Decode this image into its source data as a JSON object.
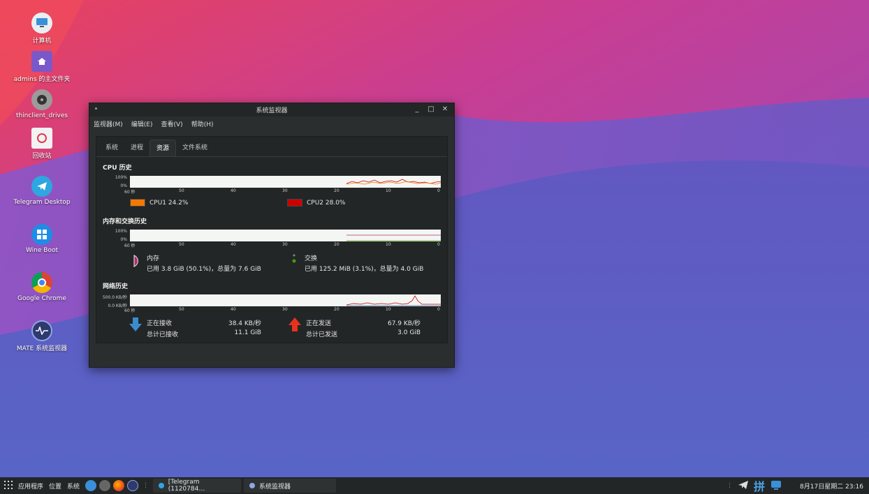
{
  "desktop": {
    "icons": [
      {
        "label": "计算机",
        "icon": "computer-icon"
      },
      {
        "label": "admins 的主文件夹",
        "icon": "home-folder-icon"
      },
      {
        "label": "thinclient_drives",
        "icon": "drive-icon"
      },
      {
        "label": "回收站",
        "icon": "trash-icon"
      },
      {
        "label": "Telegram Desktop",
        "icon": "telegram-icon"
      },
      {
        "label": "Wine Boot",
        "icon": "windows-icon"
      },
      {
        "label": "Google Chrome",
        "icon": "chrome-icon"
      },
      {
        "label": "MATE 系统监视器",
        "icon": "system-monitor-icon"
      }
    ]
  },
  "window": {
    "title": "系统监视器",
    "menu": [
      "监视器(M)",
      "编辑(E)",
      "查看(V)",
      "帮助(H)"
    ],
    "tabs": [
      "系统",
      "进程",
      "资源",
      "文件系统"
    ],
    "active_tab": "资源"
  },
  "cpu": {
    "title": "CPU 历史",
    "y_top": "100%",
    "y_bottom": "0%",
    "x_labels": [
      "60 秒",
      "50",
      "40",
      "30",
      "20",
      "10",
      "0"
    ],
    "cpu1_label": "CPU1 24.2%",
    "cpu2_label": "CPU2 28.0%",
    "cpu1_color": "#f57900",
    "cpu2_color": "#cc0000"
  },
  "memory": {
    "title": "内存和交换历史",
    "y_top": "100%",
    "y_bottom": "0%",
    "x_labels": [
      "60 秒",
      "50",
      "40",
      "30",
      "20",
      "10",
      "0"
    ],
    "mem_title": "内存",
    "mem_detail": "已用 3.8 GiB (50.1%)，总量为 7.6 GiB",
    "swap_title": "交换",
    "swap_detail": "已用 125.2 MiB (3.1%)，总量为 4.0 GiB",
    "mem_color": "#ad2f6b",
    "swap_color": "#4e9a06"
  },
  "network": {
    "title": "网络历史",
    "y_top": "500.0 KB/秒",
    "y_bottom": "0.0 KB/秒",
    "x_labels": [
      "60 秒",
      "50",
      "40",
      "30",
      "20",
      "10",
      "0"
    ],
    "recv_label": "正在接收",
    "recv_value": "38.4 KB/秒",
    "recv_total_label": "总计已接收",
    "recv_total_value": "11.1 GiB",
    "send_label": "正在发送",
    "send_value": "67.9 KB/秒",
    "send_total_label": "总计已发送",
    "send_total_value": "3.0 GiB"
  },
  "taskbar": {
    "menus": [
      "应用程序",
      "位置",
      "系统"
    ],
    "tasks": [
      "[Telegram (1120784…",
      "系统监视器"
    ],
    "clock": "8月17日星期二 23:16",
    "ime": "拼"
  }
}
